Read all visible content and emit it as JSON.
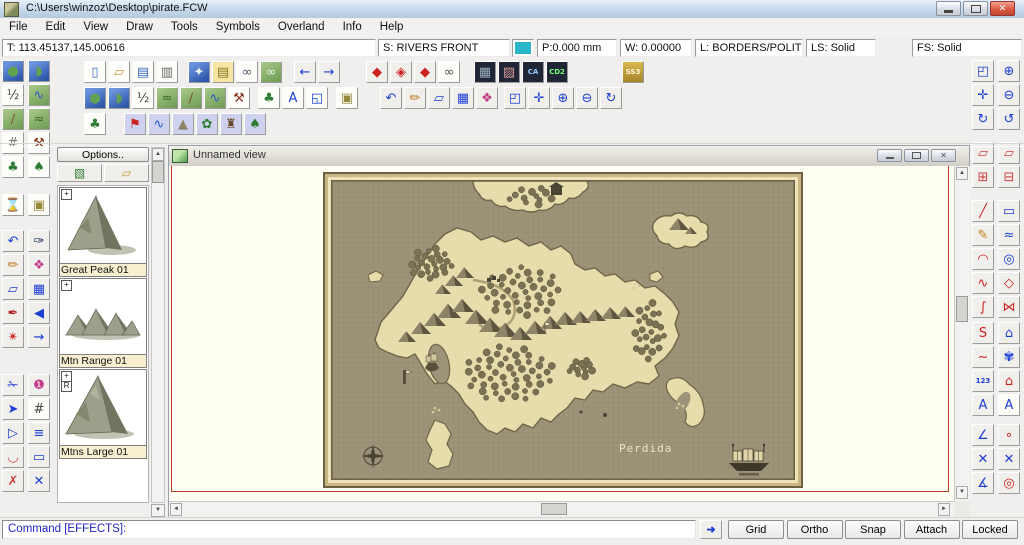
{
  "window": {
    "title": "C:\\Users\\winzoz\\Desktop\\pirate.FCW"
  },
  "menu": {
    "items": [
      "File",
      "Edit",
      "View",
      "Draw",
      "Tools",
      "Symbols",
      "Overland",
      "Info",
      "Help"
    ]
  },
  "status_bar": {
    "fields": [
      {
        "name": "tracking",
        "text": "T: 113.45137,145.00616"
      },
      {
        "name": "sheet",
        "text": "S: RIVERS FRONT"
      },
      {
        "name": "current-color",
        "swatch": "#2ab5c8"
      },
      {
        "name": "pen",
        "text": "P:0.000 mm"
      },
      {
        "name": "width",
        "text": "W: 0.00000"
      },
      {
        "name": "layer",
        "text": "L: BORDERS/POLITIC."
      },
      {
        "name": "line-style",
        "text": "LS: Solid"
      },
      {
        "name": "fill-style",
        "text": "FS: Solid"
      }
    ]
  },
  "toolbars": {
    "top1": [
      [
        {
          "n": "new-drawing",
          "g": "▯",
          "c": "#3a6ec0",
          "t": "paper"
        },
        {
          "n": "open-drawing",
          "g": "▱",
          "c": "#c89a3a",
          "t": "paper"
        },
        {
          "n": "save-drawing",
          "g": "▤",
          "c": "#3a6ec0",
          "t": "paper"
        },
        {
          "n": "print",
          "g": "▥",
          "c": "#666",
          "t": "paper"
        }
      ],
      [
        {
          "n": "insert-map",
          "g": "✦",
          "c": "#eaf5e6",
          "t": "sea"
        },
        {
          "n": "map-notes",
          "g": "▤",
          "c": "#8a7a22",
          "t": "note"
        },
        {
          "n": "link-view",
          "g": "∞",
          "c": "#445566",
          "t": "paper"
        },
        {
          "n": "link-map",
          "g": "∞",
          "c": "#e8f2e2",
          "t": "land"
        }
      ],
      [
        {
          "n": "go-back",
          "g": "←",
          "c": "#1a3fd4"
        },
        {
          "n": "go-forward",
          "g": "→",
          "c": "#1a3fd4"
        }
      ],
      [
        {
          "n": "redline-hide",
          "g": "◆",
          "c": "#cc2222"
        },
        {
          "n": "redline-prev",
          "g": "◈",
          "c": "#cc2222"
        },
        {
          "n": "redline-next",
          "g": "◆",
          "c": "#cc2222"
        },
        {
          "n": "find",
          "g": "∞",
          "c": "#555",
          "t": "paper"
        }
      ],
      [
        {
          "n": "overview-map",
          "g": "▦",
          "c": "#99aabb",
          "t": "dark"
        },
        {
          "n": "city-map",
          "g": "▨",
          "c": "#dd9999",
          "t": "dark"
        },
        {
          "n": "character-artist",
          "g": "CA",
          "c": "#99ccff",
          "t": "dark"
        },
        {
          "n": "cd2",
          "g": "CD2",
          "c": "#77ff77",
          "t": "dark"
        }
      ],
      [
        {
          "n": "source-maps-ss3",
          "g": "SS3",
          "c": "#fff6dd",
          "t": "gold"
        }
      ]
    ],
    "top2": [
      [
        {
          "n": "draw-landmass",
          "g": "●",
          "c": "#63a24f",
          "t": "sea"
        },
        {
          "n": "draw-coastline",
          "g": "◗",
          "c": "#63a24f",
          "t": "sea"
        },
        {
          "n": "map-scale",
          "g": "½",
          "c": "#444",
          "t": "paper"
        },
        {
          "n": "draw-terrain",
          "g": "≈",
          "c": "#3c6b2e",
          "t": "land"
        },
        {
          "n": "draw-path",
          "g": "∕",
          "c": "#7a5230",
          "t": "land"
        },
        {
          "n": "draw-river",
          "g": "∿",
          "c": "#2b57c9",
          "t": "land"
        },
        {
          "n": "drawing-tools",
          "g": "⚒",
          "c": "#8a3a22",
          "t": "paper"
        }
      ],
      [
        {
          "n": "symbol-manager",
          "g": "♣",
          "c": "#2e7d32",
          "t": "paper"
        },
        {
          "n": "insert-text",
          "g": "A",
          "c": "#1a3fd4",
          "t": "paper"
        },
        {
          "n": "node-edit-tools",
          "g": "◱",
          "c": "#1a3fd4",
          "t": "paper"
        }
      ],
      [
        {
          "n": "sheets-effects",
          "g": "▣",
          "c": "#96893a",
          "t": "paper"
        }
      ],
      [
        {
          "n": "undo",
          "g": "↶",
          "c": "#1a3fd4"
        },
        {
          "n": "erase",
          "g": "✏",
          "c": "#c07820"
        },
        {
          "n": "copy",
          "g": "▱",
          "c": "#1a3fd4"
        },
        {
          "n": "explode",
          "g": "▦",
          "c": "#1a3fd4"
        },
        {
          "n": "color-palette",
          "g": "❖",
          "c": "#c23a8a"
        }
      ],
      [
        {
          "n": "zoom-window",
          "g": "◰",
          "c": "#1a3fd4"
        },
        {
          "n": "zoom-extents",
          "g": "✛",
          "c": "#1a3fd4"
        },
        {
          "n": "zoom-in",
          "g": "⊕",
          "c": "#1a3fd4"
        },
        {
          "n": "zoom-out",
          "g": "⊖",
          "c": "#1a3fd4"
        },
        {
          "n": "redraw",
          "g": "↻",
          "c": "#1a3fd4"
        }
      ]
    ],
    "top3": [
      [
        {
          "n": "symbol-catalog-options",
          "g": "♣",
          "c": "#2e7d32",
          "t": "paper"
        }
      ],
      [
        {
          "n": "catalog-borders",
          "g": "⚑",
          "c": "#cc2222",
          "t": "lav"
        },
        {
          "n": "catalog-contours",
          "g": "∿",
          "c": "#2b57c9",
          "t": "lav"
        },
        {
          "n": "catalog-mountains",
          "g": "▲",
          "c": "#8d8468",
          "t": "lav"
        },
        {
          "n": "catalog-vegetation",
          "g": "✿",
          "c": "#2e7d32",
          "t": "lav"
        },
        {
          "n": "catalog-structures",
          "g": "♜",
          "c": "#6b4a2a",
          "t": "lav"
        },
        {
          "n": "catalog-trees",
          "g": "♠",
          "c": "#2e7d32",
          "t": "lav"
        }
      ]
    ],
    "left1": [
      [
        {
          "n": "landmass-tool",
          "g": "●",
          "c": "#63a24f",
          "t": "sea"
        },
        {
          "n": "map-scale-tool",
          "g": "½",
          "c": "#444",
          "t": "paper"
        },
        {
          "n": "path-tool",
          "g": "∕",
          "c": "#7a5230",
          "t": "land"
        },
        {
          "n": "grid-tool",
          "g": "#",
          "c": "#777",
          "t": "paper"
        },
        {
          "n": "symbol-place-tool",
          "g": "♣",
          "c": "#2e7d32",
          "t": "paper"
        }
      ],
      [
        {
          "n": "zoom-wait-tool",
          "g": "⌛",
          "c": "#8a6a2a",
          "t": "paper"
        }
      ],
      [
        {
          "n": "undo-tool",
          "g": "↶",
          "c": "#1a3fd4"
        },
        {
          "n": "erase-tool",
          "g": "✏",
          "c": "#c07820"
        },
        {
          "n": "copy-tool",
          "g": "▱",
          "c": "#1a3fd4"
        },
        {
          "n": "ink-tool",
          "g": "✒",
          "c": "#b02020"
        },
        {
          "n": "marker-tool",
          "g": "✴",
          "c": "#cc2222"
        }
      ],
      [
        {
          "n": "break-tool",
          "g": "✁",
          "c": "#1a3fd4"
        },
        {
          "n": "extract-plus-tool",
          "g": "➤",
          "c": "#1a3fd4"
        },
        {
          "n": "extract-tool",
          "g": "▷",
          "c": "#1a3fd4"
        },
        {
          "n": "trim-tool",
          "g": "◡",
          "c": "#cc4444"
        },
        {
          "n": "trim-cross-tool",
          "g": "✗",
          "c": "#cc4444"
        }
      ]
    ],
    "left2": [
      [
        {
          "n": "coastline-tool",
          "g": "◗",
          "c": "#63a24f",
          "t": "sea"
        },
        {
          "n": "river-tool",
          "g": "∿",
          "c": "#2b57c9",
          "t": "land"
        },
        {
          "n": "terrain-tool",
          "g": "≈",
          "c": "#3c6b2e",
          "t": "land"
        },
        {
          "n": "construction-tool",
          "g": "⚒",
          "c": "#8a3a22",
          "t": "paper"
        },
        {
          "n": "tree-tool",
          "g": "♠",
          "c": "#2e7d32",
          "t": "paper"
        }
      ],
      [
        {
          "n": "sheet-manager",
          "g": "▣",
          "c": "#96893a",
          "t": "paper"
        }
      ],
      [
        {
          "n": "eyedropper-tool",
          "g": "✑",
          "c": "#223366"
        },
        {
          "n": "palette-tool",
          "g": "❖",
          "c": "#c23a8a"
        },
        {
          "n": "group-tool",
          "g": "▦",
          "c": "#1a3fd4"
        },
        {
          "n": "trace-tool",
          "g": "◀",
          "c": "#1a3fd4"
        },
        {
          "n": "wave-offset-tool",
          "g": "⇝",
          "c": "#1a3fd4"
        }
      ],
      [
        {
          "n": "color-one-tool",
          "g": "❶",
          "c": "#c23a8a"
        },
        {
          "n": "hash-grid-tool",
          "g": "#",
          "c": "#444",
          "t": "paper"
        },
        {
          "n": "line-styles-tool",
          "g": "≡",
          "c": "#1a3fd4"
        },
        {
          "n": "fill-box-tool",
          "g": "▭",
          "c": "#1a3fd4"
        },
        {
          "n": "cross-tool",
          "g": "✕",
          "c": "#1a3fd4"
        }
      ]
    ],
    "right1": [
      [
        {
          "n": "zoom-window-side",
          "g": "◰",
          "c": "#1a3fd4"
        },
        {
          "n": "zoom-extents-side",
          "g": "✛",
          "c": "#1a3fd4"
        },
        {
          "n": "redraw-side",
          "g": "↻",
          "c": "#1a3fd4"
        }
      ],
      [
        {
          "n": "copy-to-sheet",
          "g": "▱",
          "c": "#d04040"
        },
        {
          "n": "sheet-plus",
          "g": "⊞",
          "c": "#d04040"
        }
      ],
      [
        {
          "n": "draw-line",
          "g": "╱",
          "c": "#cc2222"
        },
        {
          "n": "draw-freehand",
          "g": "✎",
          "c": "#b8860b"
        },
        {
          "n": "draw-arc",
          "g": "◠",
          "c": "#cc2222"
        },
        {
          "n": "draw-zigzag",
          "g": "∿",
          "c": "#cc2222"
        },
        {
          "n": "draw-spline",
          "g": "∫",
          "c": "#cc2222"
        }
      ],
      [
        {
          "n": "draw-smooth-poly",
          "g": "S",
          "c": "#cc2222"
        },
        {
          "n": "edit-curve",
          "g": "~",
          "c": "#cc2222"
        },
        {
          "n": "numeric-label",
          "g": "123",
          "c": "#1a3fd4"
        },
        {
          "n": "text-tool-side",
          "g": "A",
          "c": "#1a3fd4"
        }
      ],
      [
        {
          "n": "snap-endpoint",
          "g": "∠",
          "c": "#1a3fd4"
        },
        {
          "n": "snap-intersection",
          "g": "✕",
          "c": "#1a3fd4"
        },
        {
          "n": "snap-angle",
          "g": "∡",
          "c": "#1a3fd4"
        }
      ]
    ],
    "right2": [
      [
        {
          "n": "zoom-in-side",
          "g": "⊕",
          "c": "#1a3fd4"
        },
        {
          "n": "zoom-out-side",
          "g": "⊖",
          "c": "#1a3fd4"
        },
        {
          "n": "zoom-previous",
          "g": "↺",
          "c": "#1a3fd4"
        }
      ],
      [
        {
          "n": "copy-sheet-alt",
          "g": "▱",
          "c": "#d04040"
        },
        {
          "n": "sheet-minus",
          "g": "⊟",
          "c": "#d04040"
        }
      ],
      [
        {
          "n": "draw-box",
          "g": "▭",
          "c": "#1a3fd4"
        },
        {
          "n": "fill-freehand",
          "g": "≈",
          "c": "#1a3fd4"
        },
        {
          "n": "draw-circle",
          "g": "◎",
          "c": "#1a3fd4"
        },
        {
          "n": "draw-polygon",
          "g": "◇",
          "c": "#cc2222"
        },
        {
          "n": "edit-polygon",
          "g": "⋈",
          "c": "#cc2222"
        }
      ],
      [
        {
          "n": "fill-polygon",
          "g": "⌂",
          "c": "#1a3fd4"
        },
        {
          "n": "draw-blob",
          "g": "✾",
          "c": "#1a3fd4"
        },
        {
          "n": "closed-polygon",
          "g": "⌂",
          "c": "#cc2222"
        },
        {
          "n": "text-box-tool",
          "g": "A",
          "c": "#1a3fd4",
          "t": "paper"
        }
      ],
      [
        {
          "n": "node-snap",
          "g": "∘",
          "c": "#cc2222"
        },
        {
          "n": "delete-node",
          "g": "✕",
          "c": "#1a3fd4"
        },
        {
          "n": "center-snap",
          "g": "◎",
          "c": "#cc2222"
        }
      ]
    ]
  },
  "symbol_panel": {
    "options_label": "Options..",
    "catalog_buttons": [
      {
        "n": "catalog-settings"
      },
      {
        "n": "open-catalog"
      }
    ],
    "symbols": [
      {
        "label": "Great Peak 01"
      },
      {
        "label": "Mtn Range 01"
      },
      {
        "label": "Mtns Large 01"
      }
    ]
  },
  "view_window": {
    "title": "Unnamed view"
  },
  "map": {
    "label": "Perdida",
    "sea": "#9c9378",
    "land": "#e7dcab",
    "coast": "#6e6448",
    "frame_dark": "#6b5f44",
    "frame_gold": "#c9b681",
    "frame_cream": "#efe3bb",
    "forest": "#7b7254",
    "mountain_light": "#8d8468",
    "mountain_dark": "#5d5540",
    "forests": [
      [
        108,
        92,
        22,
        16,
        24
      ],
      [
        198,
        120,
        40,
        26,
        40
      ],
      [
        186,
        202,
        46,
        28,
        50
      ],
      [
        326,
        160,
        16,
        30,
        24
      ],
      [
        258,
        196,
        14,
        9,
        12
      ],
      [
        208,
        24,
        26,
        9,
        12
      ]
    ],
    "mountains": [
      [
        84,
        170,
        9
      ],
      [
        98,
        162,
        10
      ],
      [
        112,
        154,
        11
      ],
      [
        126,
        146,
        12
      ],
      [
        140,
        140,
        11
      ],
      [
        154,
        152,
        12
      ],
      [
        168,
        160,
        12
      ],
      [
        183,
        165,
        12
      ],
      [
        198,
        168,
        11
      ],
      [
        213,
        162,
        11
      ],
      [
        228,
        157,
        11
      ],
      [
        243,
        153,
        11
      ],
      [
        258,
        151,
        10
      ],
      [
        273,
        149,
        10
      ],
      [
        288,
        147,
        10
      ],
      [
        303,
        145,
        9
      ],
      [
        120,
        122,
        8
      ],
      [
        131,
        114,
        9
      ],
      [
        142,
        106,
        9
      ],
      [
        356,
        58,
        10
      ],
      [
        368,
        62,
        6
      ]
    ]
  },
  "command_bar": {
    "prompt": "Command [EFFECTS]:",
    "buttons": [
      "Grid",
      "Ortho",
      "Snap",
      "Attach",
      "Locked"
    ]
  }
}
